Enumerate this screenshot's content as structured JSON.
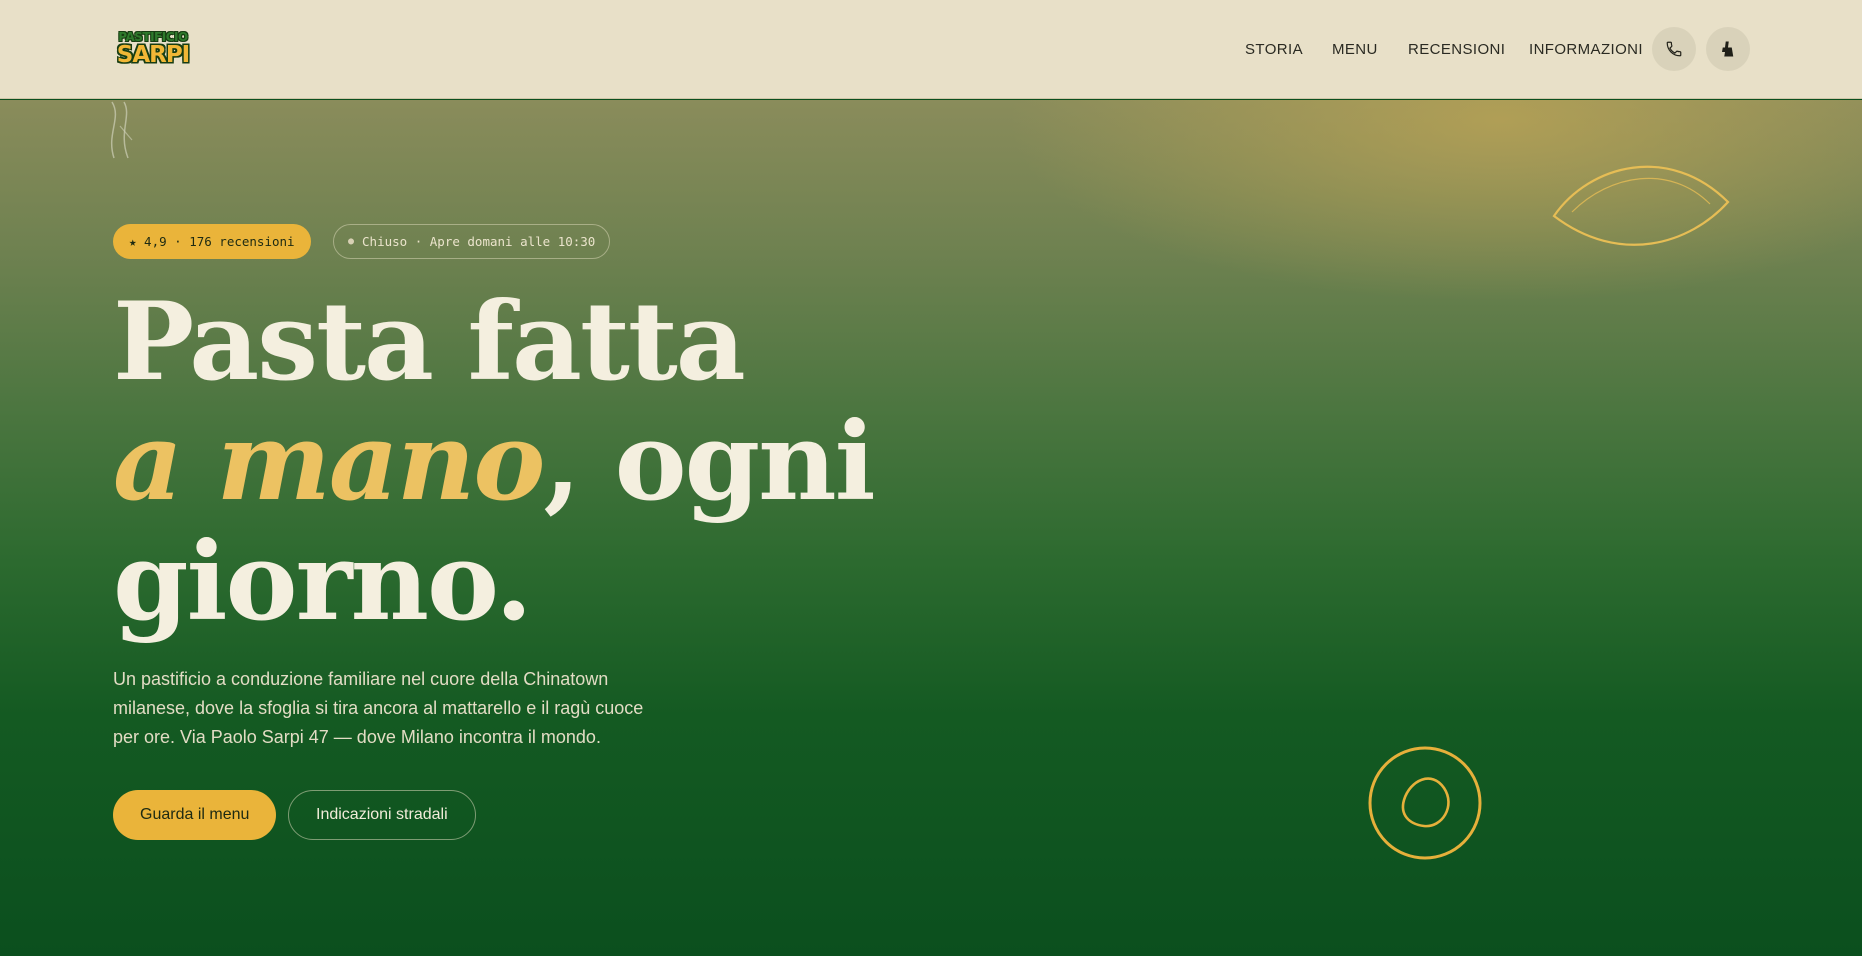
{
  "brand": {
    "logo_line1": "PASTIFICIO",
    "logo_line2": "SARPI"
  },
  "nav": {
    "items": [
      "STORIA",
      "MENU",
      "RECENSIONI",
      "INFORMAZIONI"
    ],
    "icons": [
      "phone-icon",
      "delivery-icon"
    ]
  },
  "hero": {
    "rating_badge": "★ 4,9 · 176 recensioni",
    "status_dot": "●",
    "status_text": "Chiuso · Apre domani alle 10:30",
    "headline_line1": "Pasta fatta",
    "headline_accent": "a mano",
    "headline_line2_rest": ", ogni",
    "headline_line3": "giorno.",
    "lead": "Un pastificio a conduzione familiare nel cuore della Chinatown milanese, dove la sfoglia si tira ancora al mattarello e il ragù cuoce per ore. Via Paolo Sarpi 47 — dove Milano incontra il mondo.",
    "primary_cta": "Guarda il menu",
    "secondary_cta": "Indicazioni stradali"
  },
  "colors": {
    "header_bg": "#e8e0c8",
    "accent_yellow": "#eab43a",
    "hero_green_dark": "#0b4f1e",
    "headline_cream": "#f4efdf",
    "headline_accent": "#ecc262"
  }
}
